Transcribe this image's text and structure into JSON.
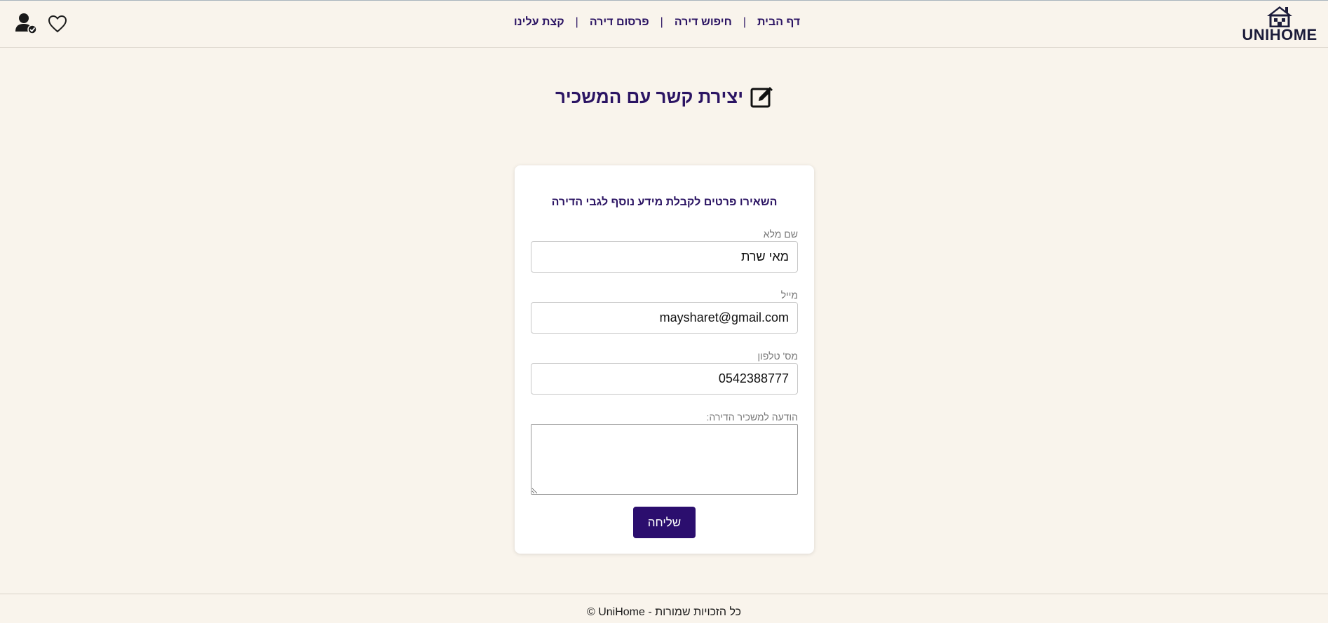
{
  "header": {
    "logo_text": "UNIHOME",
    "nav": [
      "דף הבית",
      "חיפוש דירה",
      "פרסום דירה",
      "קצת עלינו"
    ],
    "separator": "|"
  },
  "page": {
    "title": "יצירת קשר עם המשכיר"
  },
  "form": {
    "heading": "השאירו פרטים לקבלת מידע נוסף לגבי הדירה",
    "fullname_label": "שם מלא",
    "fullname_value": "מאי שרת",
    "email_label": "מייל",
    "email_value": "maysharet@gmail.com",
    "phone_label": "מס' טלפון",
    "phone_value": "0542388777",
    "message_label": "הודעה למשכיר הדירה:",
    "message_value": "",
    "submit_label": "שליחה"
  },
  "footer": {
    "text": "© UniHome - כל הזכויות שמורות"
  },
  "colors": {
    "background": "#f9f4ec",
    "accent": "#2b0e6e",
    "text": "#2b1463"
  },
  "icons": [
    "house-logo-icon",
    "user-check-icon",
    "heart-icon",
    "edit-icon"
  ]
}
